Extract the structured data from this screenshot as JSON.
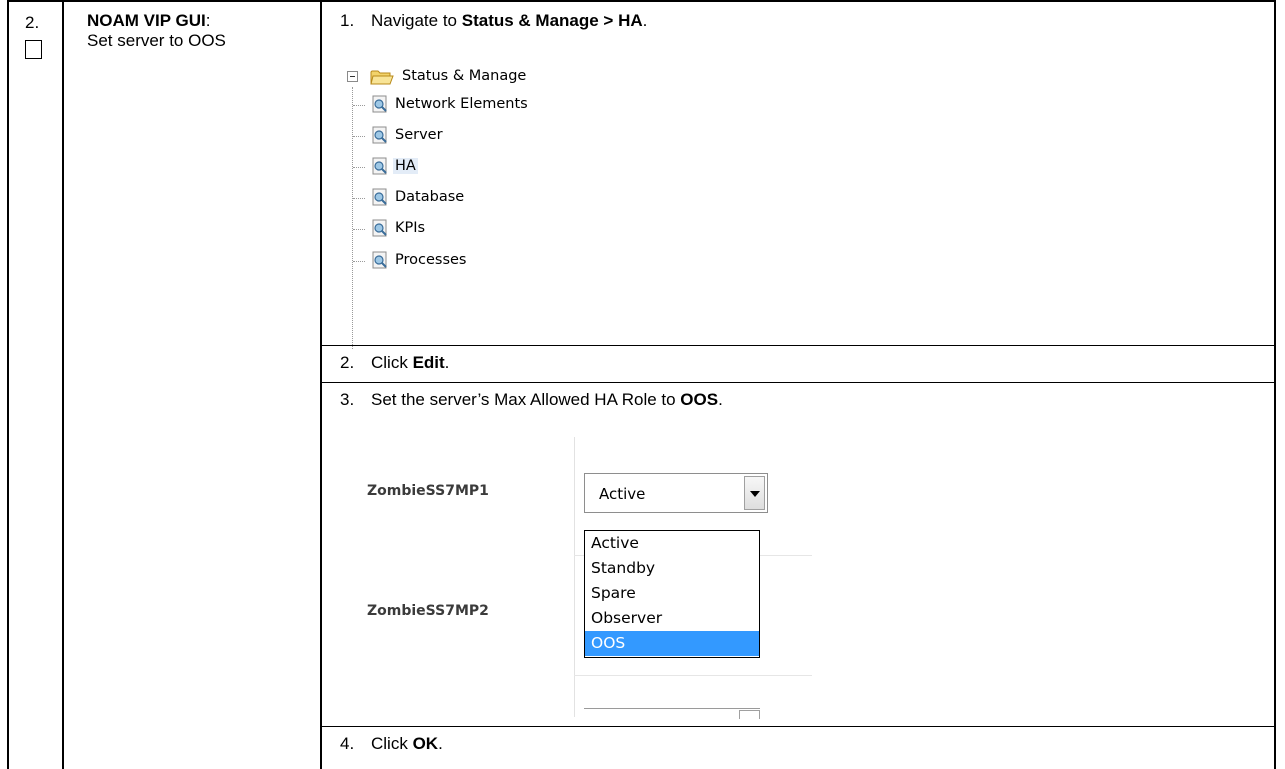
{
  "step": {
    "number": "2.",
    "name_bold": "NOAM VIP GUI",
    "name_colon": ":",
    "name_line2": "Set server to OOS"
  },
  "instructions": [
    {
      "num": "1.",
      "pre": "Navigate to ",
      "bold": "Status & Manage > HA",
      "post": "."
    },
    {
      "num": "2.",
      "pre": "Click ",
      "bold": "Edit",
      "post": "."
    },
    {
      "num": "3.",
      "pre": "Set the server’s Max Allowed HA Role to ",
      "bold": "OOS",
      "post": "."
    },
    {
      "num": "4.",
      "pre": "Click ",
      "bold": "OK",
      "post": "."
    }
  ],
  "tree": {
    "root": "Status & Manage",
    "items": [
      "Network Elements",
      "Server",
      "HA",
      "Database",
      "KPIs",
      "Processes"
    ],
    "selected": "HA",
    "icons": {
      "toggle": "collapse-minus-icon",
      "folder": "folder-open-icon",
      "page": "page-magnifier-icon"
    }
  },
  "ha_form": {
    "servers": [
      "ZombieSS7MP1",
      "ZombieSS7MP2"
    ],
    "current_value": "Active",
    "options": [
      "Active",
      "Standby",
      "Spare",
      "Observer",
      "OOS"
    ],
    "highlighted_option": "OOS",
    "highlight_color": "#3399ff"
  }
}
